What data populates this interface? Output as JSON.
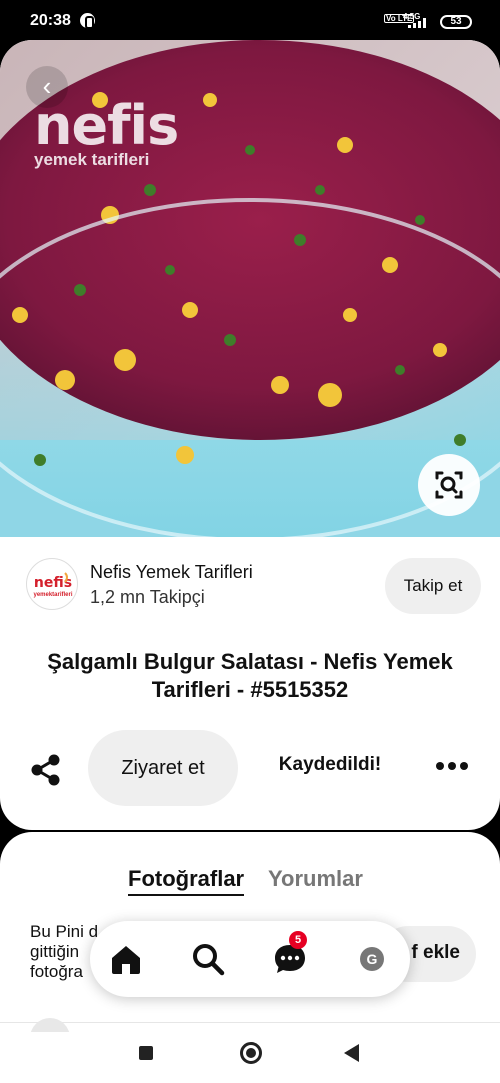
{
  "status_bar": {
    "time": "20:38",
    "network_label": "Vo LTE",
    "network_type": "4.5G",
    "battery": "53"
  },
  "pin": {
    "watermark_main": "nefis",
    "watermark_sub": "yemek tarifleri",
    "image_subject": "beet bulgur salad in a glass bowl",
    "back_icon": "chevron-left-icon",
    "visual_search_icon": "lens-search-icon"
  },
  "profile": {
    "logo_text": "nefis",
    "logo_sub": "yemektarifleri",
    "name": "Nefis Yemek Tarifleri",
    "followers": "1,2 mn Takipçi",
    "follow_label": "Takip et"
  },
  "title": "Şalgamlı Bulgur Salatası - Nefis Yemek Tarifleri - #5515352",
  "actions": {
    "share_icon": "share-icon",
    "visit_label": "Ziyaret et",
    "saved_label": "Kaydedildi!",
    "more_icon": "more-icon"
  },
  "tabs": {
    "photos": "Fotoğraflar",
    "comments": "Yorumlar"
  },
  "photos_section": {
    "note_text": "Bu Pini d\ngittiğin\nfotoğra",
    "add_label": "f ekle"
  },
  "bottom_nav": {
    "items": [
      "home-icon",
      "search-icon",
      "messages-icon",
      "profile-icon"
    ],
    "messages_badge": "5",
    "profile_initial": "G"
  },
  "colors": {
    "accent": "#e60023",
    "button_bg": "#efefef",
    "beet": "#8e1c44"
  }
}
